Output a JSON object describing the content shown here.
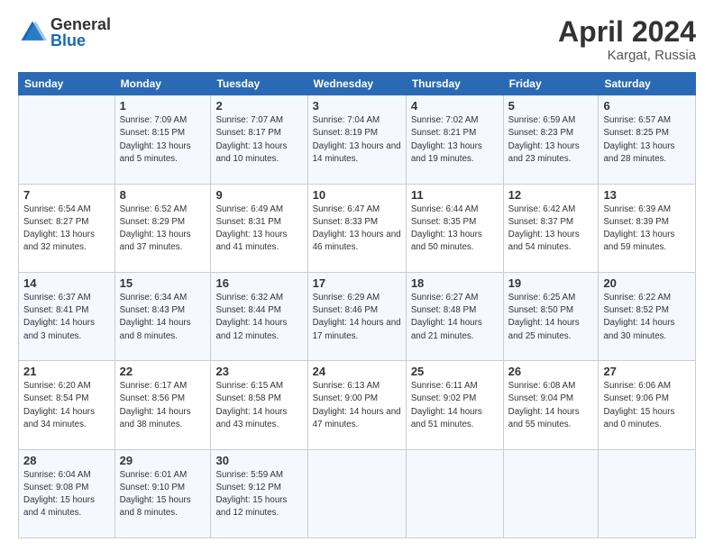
{
  "logo": {
    "general": "General",
    "blue": "Blue"
  },
  "title": "April 2024",
  "location": "Kargat, Russia",
  "days_of_week": [
    "Sunday",
    "Monday",
    "Tuesday",
    "Wednesday",
    "Thursday",
    "Friday",
    "Saturday"
  ],
  "weeks": [
    [
      {
        "day": "",
        "sunrise": "",
        "sunset": "",
        "daylight": ""
      },
      {
        "day": "1",
        "sunrise": "Sunrise: 7:09 AM",
        "sunset": "Sunset: 8:15 PM",
        "daylight": "Daylight: 13 hours and 5 minutes."
      },
      {
        "day": "2",
        "sunrise": "Sunrise: 7:07 AM",
        "sunset": "Sunset: 8:17 PM",
        "daylight": "Daylight: 13 hours and 10 minutes."
      },
      {
        "day": "3",
        "sunrise": "Sunrise: 7:04 AM",
        "sunset": "Sunset: 8:19 PM",
        "daylight": "Daylight: 13 hours and 14 minutes."
      },
      {
        "day": "4",
        "sunrise": "Sunrise: 7:02 AM",
        "sunset": "Sunset: 8:21 PM",
        "daylight": "Daylight: 13 hours and 19 minutes."
      },
      {
        "day": "5",
        "sunrise": "Sunrise: 6:59 AM",
        "sunset": "Sunset: 8:23 PM",
        "daylight": "Daylight: 13 hours and 23 minutes."
      },
      {
        "day": "6",
        "sunrise": "Sunrise: 6:57 AM",
        "sunset": "Sunset: 8:25 PM",
        "daylight": "Daylight: 13 hours and 28 minutes."
      }
    ],
    [
      {
        "day": "7",
        "sunrise": "Sunrise: 6:54 AM",
        "sunset": "Sunset: 8:27 PM",
        "daylight": "Daylight: 13 hours and 32 minutes."
      },
      {
        "day": "8",
        "sunrise": "Sunrise: 6:52 AM",
        "sunset": "Sunset: 8:29 PM",
        "daylight": "Daylight: 13 hours and 37 minutes."
      },
      {
        "day": "9",
        "sunrise": "Sunrise: 6:49 AM",
        "sunset": "Sunset: 8:31 PM",
        "daylight": "Daylight: 13 hours and 41 minutes."
      },
      {
        "day": "10",
        "sunrise": "Sunrise: 6:47 AM",
        "sunset": "Sunset: 8:33 PM",
        "daylight": "Daylight: 13 hours and 46 minutes."
      },
      {
        "day": "11",
        "sunrise": "Sunrise: 6:44 AM",
        "sunset": "Sunset: 8:35 PM",
        "daylight": "Daylight: 13 hours and 50 minutes."
      },
      {
        "day": "12",
        "sunrise": "Sunrise: 6:42 AM",
        "sunset": "Sunset: 8:37 PM",
        "daylight": "Daylight: 13 hours and 54 minutes."
      },
      {
        "day": "13",
        "sunrise": "Sunrise: 6:39 AM",
        "sunset": "Sunset: 8:39 PM",
        "daylight": "Daylight: 13 hours and 59 minutes."
      }
    ],
    [
      {
        "day": "14",
        "sunrise": "Sunrise: 6:37 AM",
        "sunset": "Sunset: 8:41 PM",
        "daylight": "Daylight: 14 hours and 3 minutes."
      },
      {
        "day": "15",
        "sunrise": "Sunrise: 6:34 AM",
        "sunset": "Sunset: 8:43 PM",
        "daylight": "Daylight: 14 hours and 8 minutes."
      },
      {
        "day": "16",
        "sunrise": "Sunrise: 6:32 AM",
        "sunset": "Sunset: 8:44 PM",
        "daylight": "Daylight: 14 hours and 12 minutes."
      },
      {
        "day": "17",
        "sunrise": "Sunrise: 6:29 AM",
        "sunset": "Sunset: 8:46 PM",
        "daylight": "Daylight: 14 hours and 17 minutes."
      },
      {
        "day": "18",
        "sunrise": "Sunrise: 6:27 AM",
        "sunset": "Sunset: 8:48 PM",
        "daylight": "Daylight: 14 hours and 21 minutes."
      },
      {
        "day": "19",
        "sunrise": "Sunrise: 6:25 AM",
        "sunset": "Sunset: 8:50 PM",
        "daylight": "Daylight: 14 hours and 25 minutes."
      },
      {
        "day": "20",
        "sunrise": "Sunrise: 6:22 AM",
        "sunset": "Sunset: 8:52 PM",
        "daylight": "Daylight: 14 hours and 30 minutes."
      }
    ],
    [
      {
        "day": "21",
        "sunrise": "Sunrise: 6:20 AM",
        "sunset": "Sunset: 8:54 PM",
        "daylight": "Daylight: 14 hours and 34 minutes."
      },
      {
        "day": "22",
        "sunrise": "Sunrise: 6:17 AM",
        "sunset": "Sunset: 8:56 PM",
        "daylight": "Daylight: 14 hours and 38 minutes."
      },
      {
        "day": "23",
        "sunrise": "Sunrise: 6:15 AM",
        "sunset": "Sunset: 8:58 PM",
        "daylight": "Daylight: 14 hours and 43 minutes."
      },
      {
        "day": "24",
        "sunrise": "Sunrise: 6:13 AM",
        "sunset": "Sunset: 9:00 PM",
        "daylight": "Daylight: 14 hours and 47 minutes."
      },
      {
        "day": "25",
        "sunrise": "Sunrise: 6:11 AM",
        "sunset": "Sunset: 9:02 PM",
        "daylight": "Daylight: 14 hours and 51 minutes."
      },
      {
        "day": "26",
        "sunrise": "Sunrise: 6:08 AM",
        "sunset": "Sunset: 9:04 PM",
        "daylight": "Daylight: 14 hours and 55 minutes."
      },
      {
        "day": "27",
        "sunrise": "Sunrise: 6:06 AM",
        "sunset": "Sunset: 9:06 PM",
        "daylight": "Daylight: 15 hours and 0 minutes."
      }
    ],
    [
      {
        "day": "28",
        "sunrise": "Sunrise: 6:04 AM",
        "sunset": "Sunset: 9:08 PM",
        "daylight": "Daylight: 15 hours and 4 minutes."
      },
      {
        "day": "29",
        "sunrise": "Sunrise: 6:01 AM",
        "sunset": "Sunset: 9:10 PM",
        "daylight": "Daylight: 15 hours and 8 minutes."
      },
      {
        "day": "30",
        "sunrise": "Sunrise: 5:59 AM",
        "sunset": "Sunset: 9:12 PM",
        "daylight": "Daylight: 15 hours and 12 minutes."
      },
      {
        "day": "",
        "sunrise": "",
        "sunset": "",
        "daylight": ""
      },
      {
        "day": "",
        "sunrise": "",
        "sunset": "",
        "daylight": ""
      },
      {
        "day": "",
        "sunrise": "",
        "sunset": "",
        "daylight": ""
      },
      {
        "day": "",
        "sunrise": "",
        "sunset": "",
        "daylight": ""
      }
    ]
  ]
}
